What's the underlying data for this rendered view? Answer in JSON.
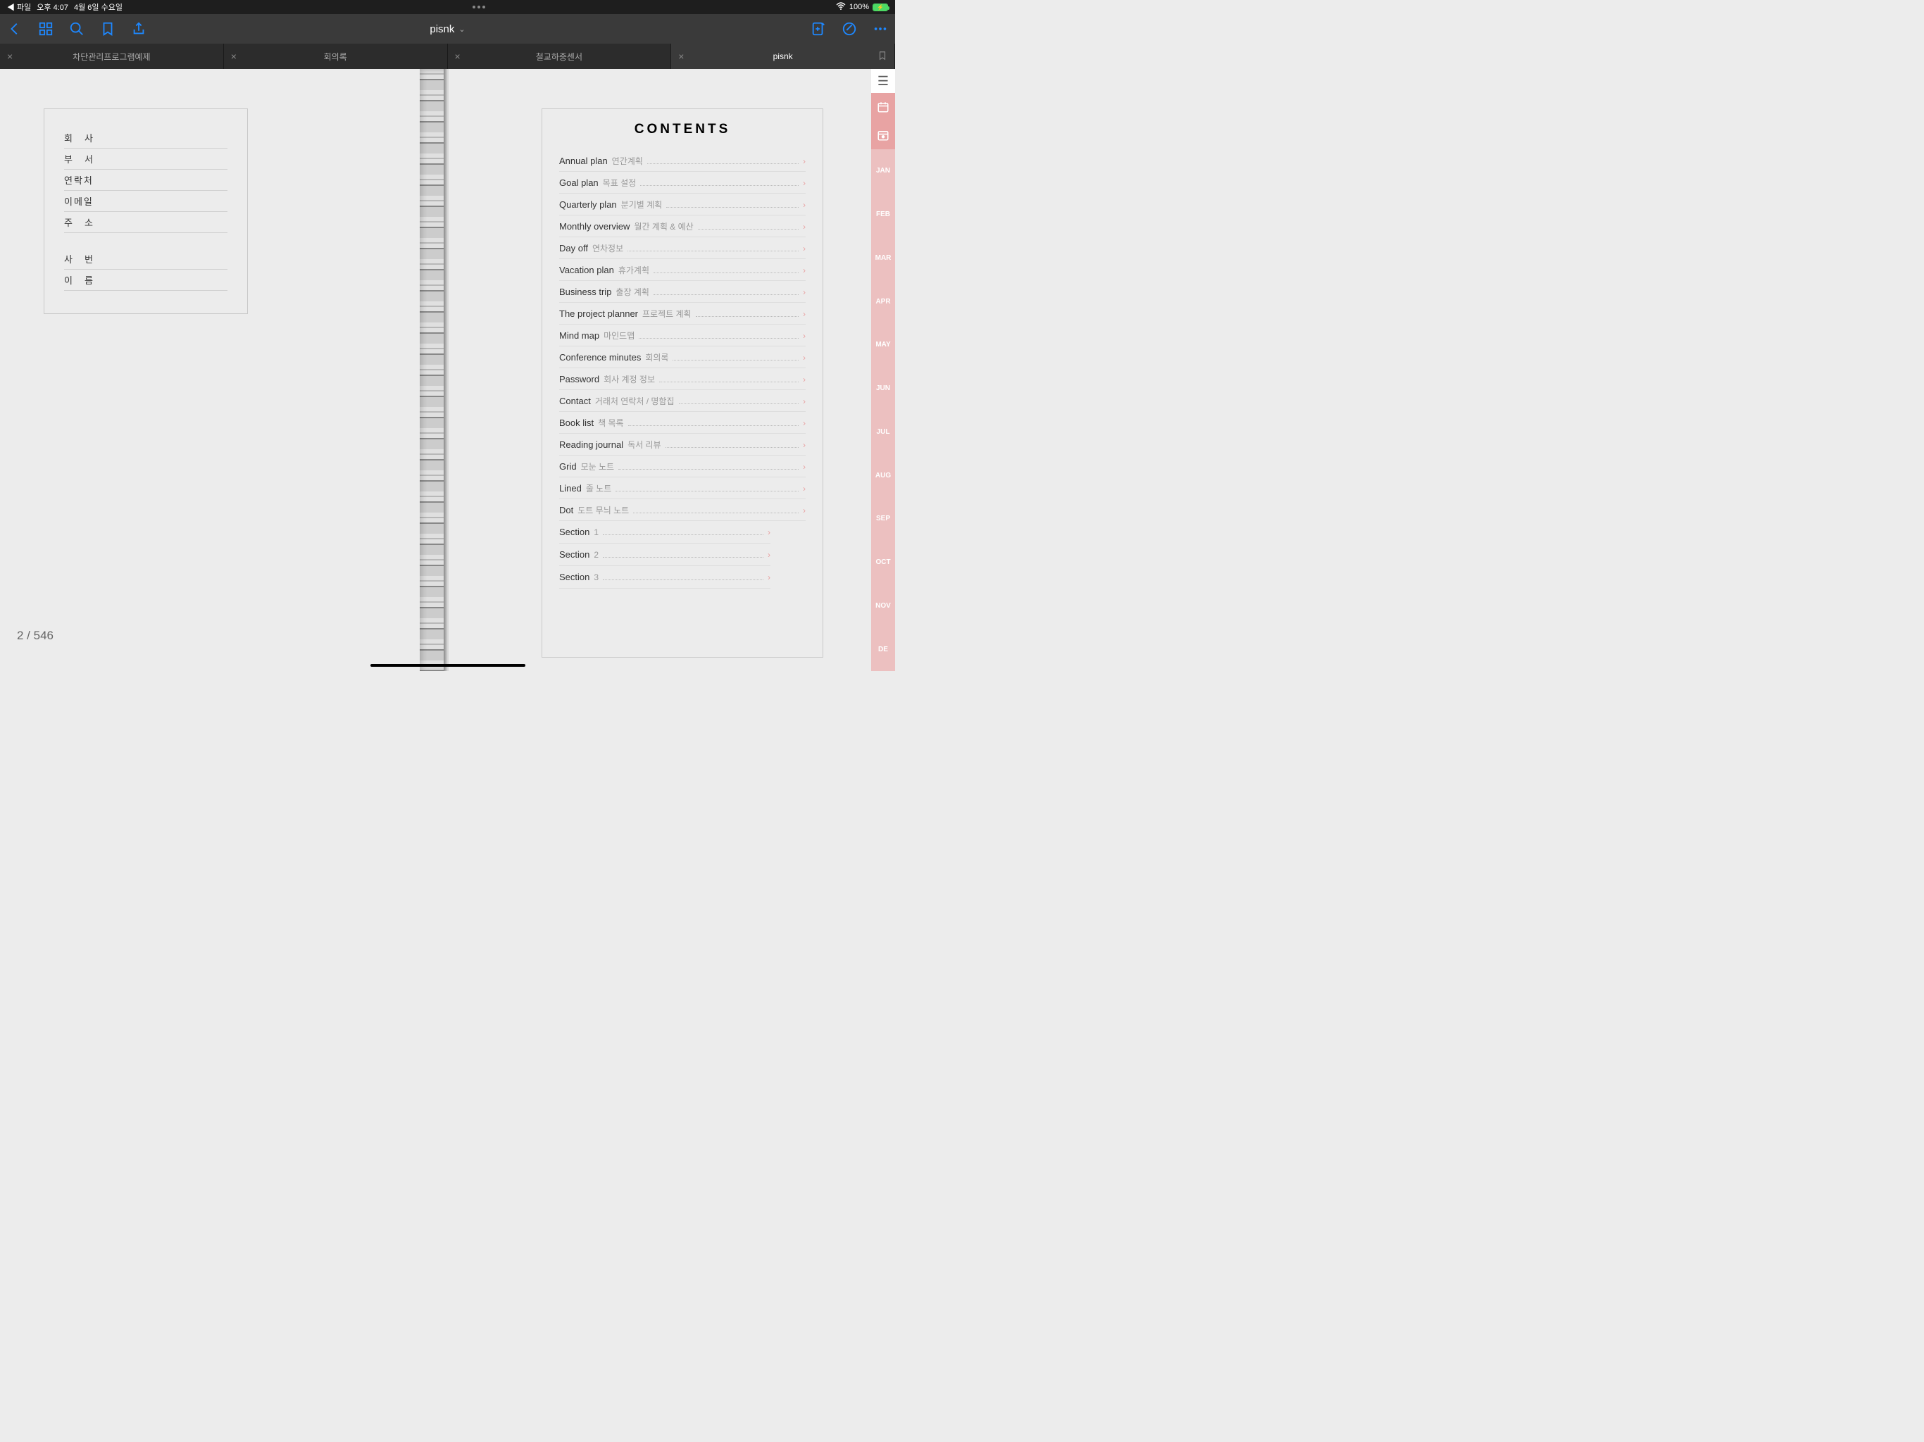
{
  "status": {
    "back_app": "◀ 파일",
    "time": "오후 4:07",
    "date": "4월 6일 수요일",
    "wifi": "wifi",
    "battery_pct": "100%"
  },
  "toolbar": {
    "doc_title": "pisnk"
  },
  "tabs": [
    {
      "label": "차단관리프로그램예제"
    },
    {
      "label": "회의록"
    },
    {
      "label": "철교하중센서"
    },
    {
      "label": "pisnk",
      "active": true
    }
  ],
  "left_fields": [
    "회　사",
    "부　서",
    "연락처",
    "이메일",
    "주　소"
  ],
  "left_fields2": [
    "사　번",
    "이　름"
  ],
  "contents_title": "CONTENTS",
  "toc": [
    {
      "en": "Annual plan",
      "ko": "연간계획"
    },
    {
      "en": "Goal plan",
      "ko": "목표 설정"
    },
    {
      "en": "Quarterly plan",
      "ko": "분기별 계획"
    },
    {
      "en": "Monthly overview",
      "ko": "월간 계획 & 예산"
    },
    {
      "en": "Day off",
      "ko": "연차정보"
    },
    {
      "en": "Vacation plan",
      "ko": "휴가계획"
    },
    {
      "en": "Business trip",
      "ko": "출장 계획"
    },
    {
      "en": "The project planner",
      "ko": "프로젝트 계획"
    },
    {
      "en": "Mind map",
      "ko": "마인드맵"
    },
    {
      "en": "Conference minutes",
      "ko": "회의록"
    },
    {
      "en": "Password",
      "ko": "회사 계정 정보"
    },
    {
      "en": "Contact",
      "ko": "거래처 연락처 / 명함집"
    },
    {
      "en": "Book list",
      "ko": "책 목록"
    },
    {
      "en": "Reading journal",
      "ko": "독서 리뷰"
    },
    {
      "en": "Grid",
      "ko": "모눈 노트"
    },
    {
      "en": "Lined",
      "ko": "줄 노트"
    },
    {
      "en": "Dot",
      "ko": "도트 무늬 노트"
    }
  ],
  "sections": [
    {
      "en": "Section",
      "ko": "1"
    },
    {
      "en": "Section",
      "ko": "2"
    },
    {
      "en": "Section",
      "ko": "3"
    }
  ],
  "months": [
    "JAN",
    "FEB",
    "MAR",
    "APR",
    "MAY",
    "JUN",
    "JUL",
    "AUG",
    "SEP",
    "OCT",
    "NOV",
    "DE"
  ],
  "page_indicator": "2 / 546"
}
